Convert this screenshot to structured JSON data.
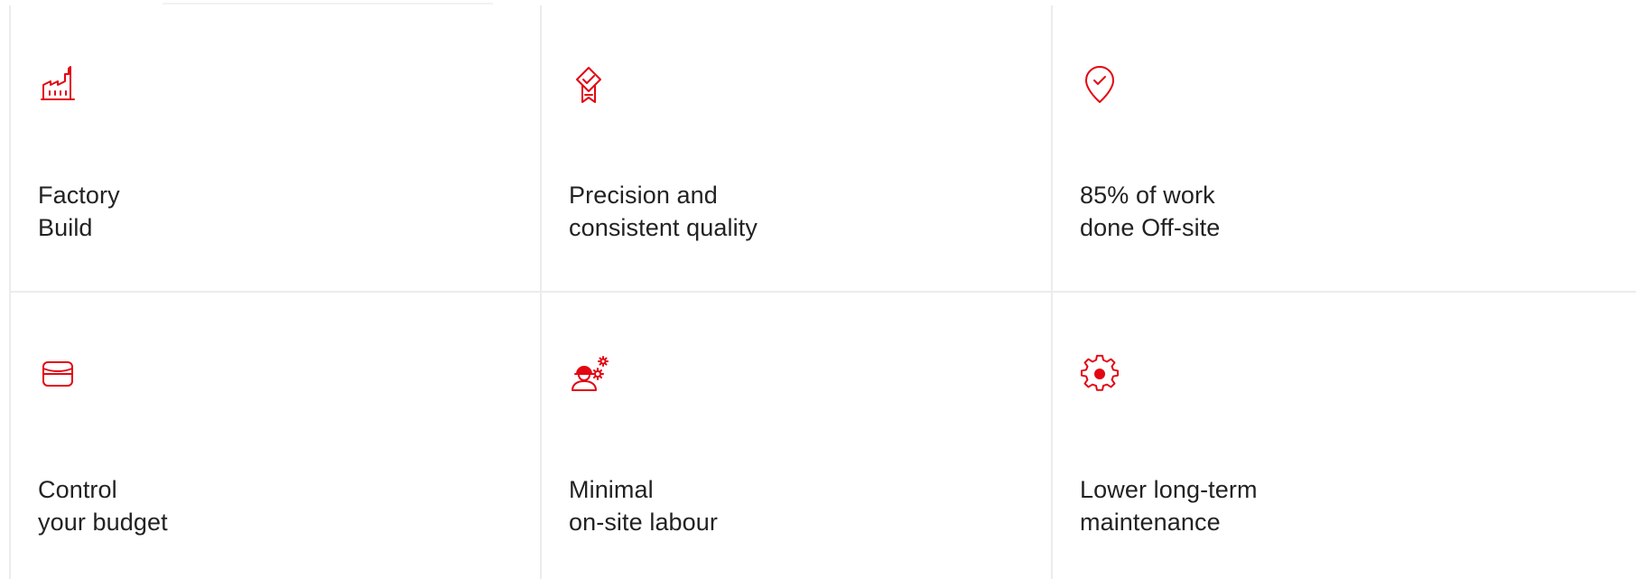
{
  "accent_color": "#e30613",
  "features": [
    {
      "icon": "factory-icon",
      "line1": "Factory",
      "line2": "Build"
    },
    {
      "icon": "quality-badge-icon",
      "line1": "Precision and",
      "line2": "consistent quality"
    },
    {
      "icon": "location-check-icon",
      "line1": "85% of work",
      "line2": "done Off-site"
    },
    {
      "icon": "budget-card-icon",
      "line1": "Control",
      "line2": "your budget"
    },
    {
      "icon": "worker-gears-icon",
      "line1": "Minimal",
      "line2": "on-site labour"
    },
    {
      "icon": "maintenance-gear-icon",
      "line1": "Lower long-term",
      "line2": "maintenance"
    }
  ]
}
